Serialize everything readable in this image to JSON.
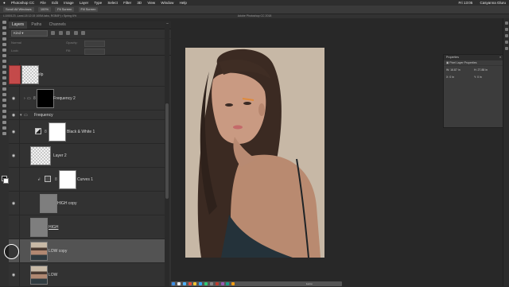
{
  "menubar": {
    "app": "Photoshop CC",
    "items": [
      "File",
      "Edit",
      "Image",
      "Layer",
      "Type",
      "Select",
      "Filter",
      "3D",
      "View",
      "Window",
      "Help"
    ],
    "clock": "Fri 13:05",
    "user": "Casyanna Gluru"
  },
  "optionsbar": {
    "pills": [
      "Scroll All Windows",
      "100%",
      "Fit Screen",
      "Fill Screen"
    ]
  },
  "titlebar": {
    "title": "Adobe Photoshop CC 2018",
    "document": "L1000123 -Land-18 12:15 100M-labo, RGB/8*) • Spring 6%"
  },
  "layers_panel": {
    "tabs": [
      "Layers",
      "Paths",
      "Channels"
    ],
    "filter_kind": "Kind",
    "blend_mode": "Normal",
    "opacity_label": "Opacity:",
    "lock_label": "Lock:",
    "fill_label": "Fill:",
    "layers": [
      {
        "name": "help",
        "type": "pixel",
        "visible": false,
        "thumb": "red-checker"
      },
      {
        "name": "Frequency 2",
        "type": "group-with-mask",
        "visible": true,
        "thumb": "black-mask"
      },
      {
        "name": "Frequency",
        "type": "group",
        "visible": true
      },
      {
        "name": "Black & White 1",
        "type": "adjustment",
        "visible": true,
        "thumb": "white-mask"
      },
      {
        "name": "Layer 2",
        "type": "pixel",
        "visible": true,
        "thumb": "checker"
      },
      {
        "name": "Curves 1",
        "type": "adjustment-clipped",
        "visible": false,
        "thumb": "white-mask"
      },
      {
        "name": "HIGH copy",
        "type": "pixel",
        "visible": true,
        "thumb": "gray"
      },
      {
        "name": "HIGH",
        "type": "pixel",
        "visible": false,
        "thumb": "gray"
      },
      {
        "name": "LOW copy",
        "type": "pixel",
        "visible": true,
        "selected": true,
        "thumb": "portrait"
      },
      {
        "name": "LOW",
        "type": "pixel",
        "visible": true,
        "thumb": "portrait"
      }
    ]
  },
  "properties_panel": {
    "title": "Properties",
    "subtitle": "Pixel Layer Properties",
    "w": "W: 16.87 in",
    "h": "H: 27.88 in",
    "x": "X: 0 in",
    "y": "Y: 0 in"
  },
  "dock": {
    "label": "Lumu"
  },
  "colors": {
    "selected_layer": "#535353",
    "panel_bg": "#323232",
    "canvas_bg": "#282828"
  }
}
